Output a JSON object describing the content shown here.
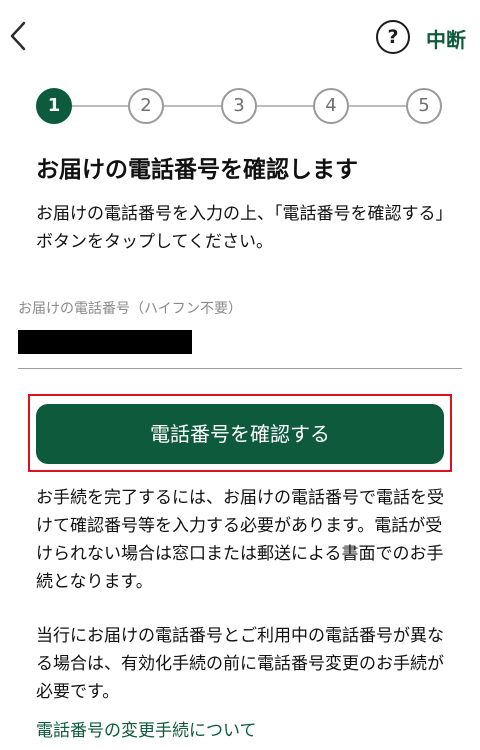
{
  "header": {
    "help_icon_glyph": "?",
    "stop_label": "中断"
  },
  "stepper": {
    "current_step": 1,
    "steps": [
      "1",
      "2",
      "3",
      "4",
      "5"
    ]
  },
  "page": {
    "title": "お届けの電話番号を確認します",
    "description": "お届けの電話番号を入力の上、「電話番号を確認する」ボタンをタップしてください。"
  },
  "phone_field": {
    "label": "お届けの電話番号（ハイフン不要）",
    "value": ""
  },
  "confirm_button": {
    "label": "電話番号を確認する"
  },
  "notes": [
    "お手続を完了するには、お届けの電話番号で電話を受けて確認番号等を入力する必要があります。電話が受けられない場合は窓口または郵送による書面でのお手続となります。",
    "当行にお届けの電話番号とご利用中の電話番号が異なる場合は、有効化手続の前に電話番号変更のお手続が必要です。"
  ],
  "change_link": {
    "label": "電話番号の変更手続について"
  },
  "colors": {
    "brand_green": "#0e5a3c",
    "highlight_red": "#e0101e",
    "inactive_step": "#9a9a9a"
  }
}
